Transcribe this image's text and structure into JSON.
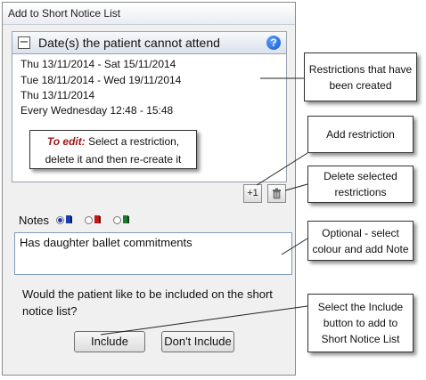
{
  "window": {
    "title": "Add to Short Notice List"
  },
  "restrictions": {
    "collapse_symbol": "−",
    "title": "Date(s) the patient cannot attend",
    "help_symbol": "?",
    "items": [
      "Thu 13/11/2014 - Sat 15/11/2014",
      "Tue 18/11/2014 - Wed 19/11/2014",
      "Thu 13/11/2014",
      "Every Wednesday 12:48 - 15:48"
    ],
    "tip_emphasis": "To edit:",
    "tip_line1": " Select a restriction,",
    "tip_line2": "delete it and then re-create it",
    "add_symbol": "+1",
    "delete_symbol": "🗑"
  },
  "notes": {
    "label": "Notes",
    "value": "Has daughter ballet commitments",
    "colours": [
      {
        "name": "blue",
        "hex": "#1a3fb5",
        "selected": true
      },
      {
        "name": "red",
        "hex": "#c01a1a",
        "selected": false
      },
      {
        "name": "green",
        "hex": "#1b7a2a",
        "selected": false
      }
    ]
  },
  "question": "Would the patient like to be included on the short notice list?",
  "buttons": {
    "include": "Include",
    "dont_include": "Don't Include"
  },
  "callouts": {
    "restrictions_created": "Restrictions that have been created",
    "add_restriction": "Add restriction",
    "delete_restrictions": "Delete selected restrictions",
    "optional_note": "Optional - select colour and add Note",
    "include_help": "Select the Include button to add to Short Notice List"
  }
}
